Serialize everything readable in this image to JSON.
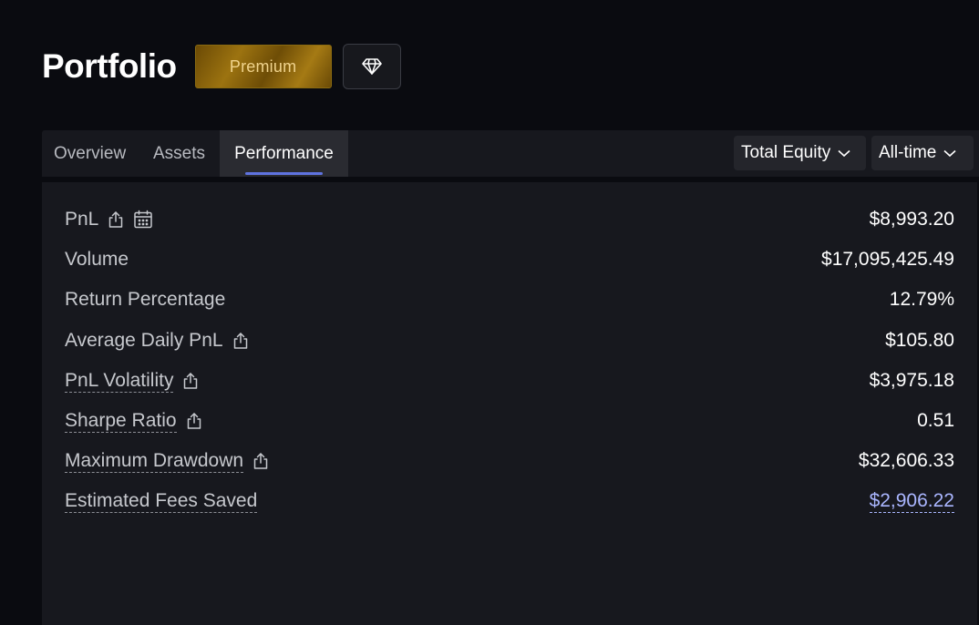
{
  "header": {
    "title": "Portfolio",
    "premium_label": "Premium",
    "diamond_icon": "diamond-icon"
  },
  "tabs": [
    {
      "label": "Overview",
      "active": false
    },
    {
      "label": "Assets",
      "active": false
    },
    {
      "label": "Performance",
      "active": true
    }
  ],
  "filters": {
    "metric": "Total Equity",
    "range": "All-time"
  },
  "metrics": [
    {
      "label": "PnL",
      "value": "$8,993.20",
      "icons": [
        "share-icon",
        "calendar-icon"
      ]
    },
    {
      "label": "Volume",
      "value": "$17,095,425.49",
      "icons": []
    },
    {
      "label": "Return Percentage",
      "value": "12.79%",
      "icons": []
    },
    {
      "label": "Average Daily PnL",
      "value": "$105.80",
      "icons": [
        "share-icon"
      ]
    },
    {
      "label": "PnL Volatility",
      "value": "$3,975.18",
      "icons": [
        "share-icon"
      ]
    },
    {
      "label": "Sharpe Ratio",
      "value": "0.51",
      "icons": [
        "share-icon"
      ]
    },
    {
      "label": "Maximum Drawdown",
      "value": "$32,606.33",
      "icons": [
        "share-icon"
      ]
    },
    {
      "label": "Estimated Fees Saved",
      "value": "$2,906.22",
      "icons": []
    }
  ],
  "colors": {
    "accent": "#5f73e0",
    "link": "#aab6ff",
    "premium_gold": "#9c7310"
  }
}
